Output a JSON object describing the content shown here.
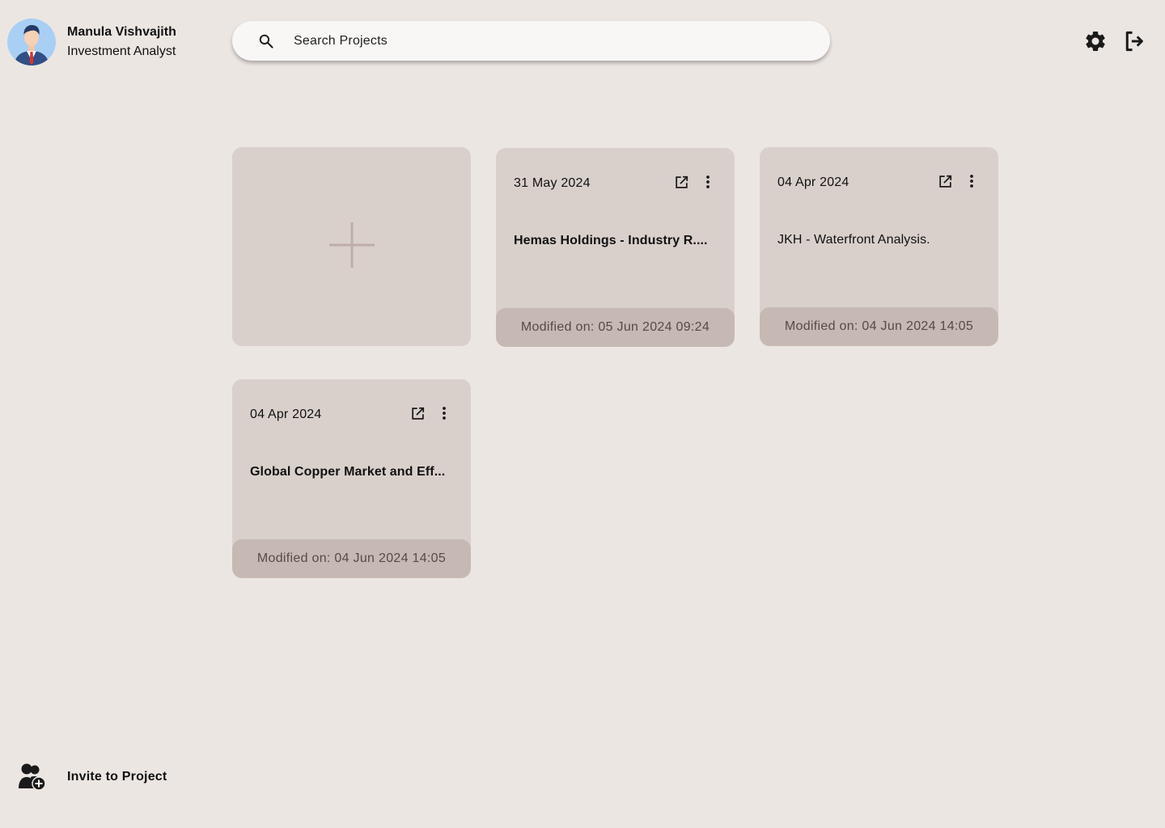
{
  "user": {
    "name": "Manula Vishvajith",
    "role": "Investment Analyst"
  },
  "search": {
    "placeholder": "Search Projects",
    "value": ""
  },
  "header": {
    "icons": [
      "gear-icon",
      "logout-icon"
    ]
  },
  "projects": {
    "new_card_icon": "plus-icon",
    "cards": [
      {
        "date": "31 May 2024",
        "title": "Hemas Holdings - Industry R....",
        "modified": "Modified on: 05 Jun 2024 09:24"
      },
      {
        "date": "04 Apr 2024",
        "title": "JKH - Waterfront Analysis.",
        "modified": "Modified on: 04 Jun 2024 14:05"
      },
      {
        "date": "04 Apr 2024",
        "title": "Global Copper Market and Eff...",
        "modified": "Modified on: 04 Jun 2024 14:05"
      }
    ]
  },
  "footer": {
    "invite_label": "Invite to Project"
  },
  "colors": {
    "background": "#ece6e3",
    "card": "#d9d0cc",
    "card_footer": "#c6b9b4",
    "plus": "#bfaea7"
  }
}
